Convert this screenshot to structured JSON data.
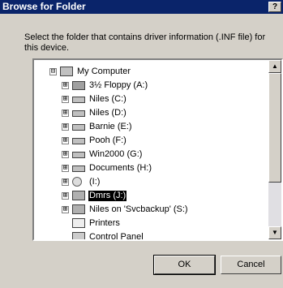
{
  "window": {
    "title": "Browse for Folder",
    "help_label": "?"
  },
  "instruction": "Select the folder that contains driver information (.INF file) for this device.",
  "tree": {
    "items": [
      {
        "label": "My Computer",
        "icon": "computer-icon",
        "expander": "⊟"
      },
      {
        "label": "3½ Floppy (A:)",
        "icon": "floppy-icon",
        "expander": "⊞"
      },
      {
        "label": "Niles (C:)",
        "icon": "drive-icon",
        "expander": "⊞"
      },
      {
        "label": "Niles (D:)",
        "icon": "drive-icon",
        "expander": "⊞"
      },
      {
        "label": "Barnie (E:)",
        "icon": "drive-icon",
        "expander": "⊞"
      },
      {
        "label": "Pooh (F:)",
        "icon": "drive-icon",
        "expander": "⊞"
      },
      {
        "label": "Win2000 (G:)",
        "icon": "drive-icon",
        "expander": "⊞"
      },
      {
        "label": "Documents (H:)",
        "icon": "drive-icon",
        "expander": "⊞"
      },
      {
        "label": "(I:)",
        "icon": "cd-drive-icon",
        "expander": "⊞"
      },
      {
        "label": "Dmrs (J:)",
        "icon": "network-drive-icon",
        "expander": "⊞",
        "selected": true
      },
      {
        "label": "Niles on 'Svcbackup' (S:)",
        "icon": "network-drive-icon",
        "expander": "⊞"
      },
      {
        "label": "Printers",
        "icon": "printers-icon"
      },
      {
        "label": "Control Panel",
        "icon": "control-panel-icon"
      }
    ]
  },
  "buttons": {
    "ok": "OK",
    "cancel": "Cancel"
  },
  "scroll": {
    "up_glyph": "▲",
    "down_glyph": "▼"
  }
}
